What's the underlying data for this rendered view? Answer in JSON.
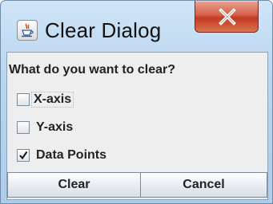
{
  "window": {
    "title": "Clear Dialog",
    "icon": "java-cup-icon",
    "close_icon": "close-icon"
  },
  "dialog": {
    "question": "What do you want to clear?",
    "options": [
      {
        "label": "X-axis",
        "checked": false
      },
      {
        "label": "Y-axis",
        "checked": false
      },
      {
        "label": "Data Points",
        "checked": true
      }
    ],
    "buttons": {
      "clear": "Clear",
      "cancel": "Cancel"
    }
  },
  "colors": {
    "titlebar": "#b9d5ef",
    "close_button": "#c23b22",
    "panel": "#eeeeee"
  }
}
